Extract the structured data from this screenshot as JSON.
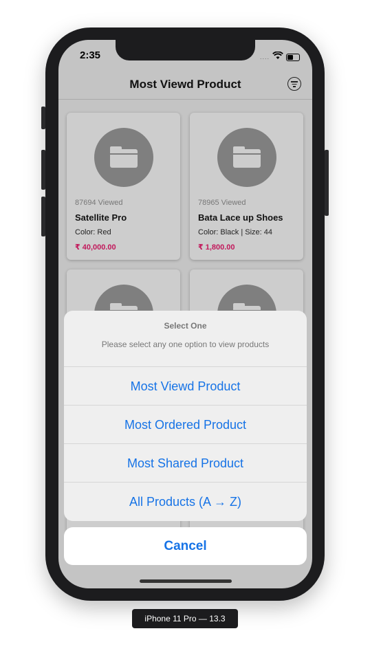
{
  "status_bar": {
    "time": "2:35",
    "signal": "....",
    "wifi_icon": "wifi-icon",
    "battery_icon": "battery-icon"
  },
  "nav": {
    "title": "Most Viewd Product",
    "filter_icon": "filter-icon"
  },
  "products": [
    {
      "views": "87694 Viewed",
      "name": "Satellite Pro",
      "attributes": "Color: Red",
      "price": "₹ 40,000.00",
      "image_icon": "folder-icon"
    },
    {
      "views": "78965 Viewed",
      "name": "Bata Lace up Shoes",
      "attributes": "Color: Black | Size: 44",
      "price": "₹ 1,800.00",
      "image_icon": "folder-icon"
    },
    {
      "image_icon": "folder-icon"
    },
    {
      "image_icon": "folder-icon"
    }
  ],
  "action_sheet": {
    "title": "Select One",
    "message": "Please select any one option to view products",
    "options": [
      "Most Viewd Product",
      "Most Ordered Product",
      "Most Shared Product",
      "All Products (A → Z)"
    ],
    "cancel": "Cancel"
  },
  "device_label": "iPhone 11 Pro — 13.3",
  "colors": {
    "accent_blue": "#1673e6",
    "price_pink": "#c2185b",
    "device_frame": "#1c1c1e"
  }
}
